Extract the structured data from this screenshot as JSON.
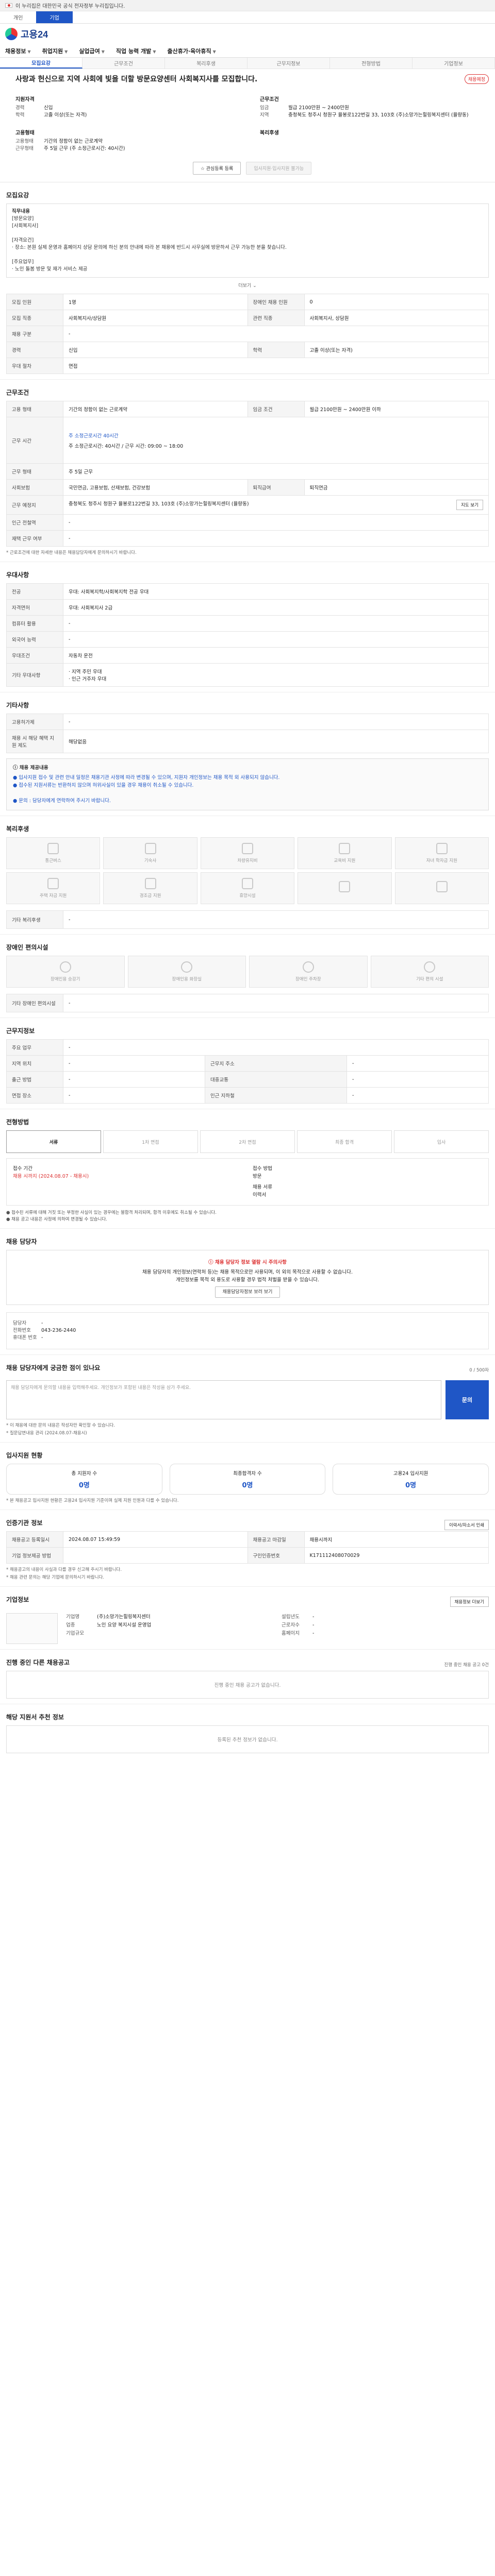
{
  "gov_banner": "이 누리집은 대한민국 공식 전자정부 누리집입니다.",
  "topbar": {
    "tabs": [
      "개인",
      "기업"
    ]
  },
  "logo_text": "고용24",
  "gnb": [
    "채용정보",
    "취업지원",
    "실업급여",
    "직업 능력 개발",
    "출산휴가·육아휴직"
  ],
  "subtabs": [
    "모집요강",
    "근무조건",
    "복리후생",
    "근무지정보",
    "전형방법",
    "기업정보"
  ],
  "header": {
    "company": "",
    "title": "사랑과 헌신으로 지역 사회에 빛을 더할 방문요양센터 사회복지사를 모집합니다.",
    "badge": "채용예정",
    "qual_title": "지원자격",
    "qual": [
      {
        "k": "경력",
        "v": "신입"
      },
      {
        "k": "학력",
        "v": "고졸 이상(또는 자격)"
      }
    ],
    "cond_title": "근무조건",
    "cond": [
      {
        "k": "임금",
        "v": "월급 2100만원 ~ 2400만원"
      },
      {
        "k": "지역",
        "v": "충청북도 청주시 청원구 율봉로122번길 33, 103호 (주)소망가는힐링복지센터 (율량동)"
      }
    ],
    "emp_title": "고용형태",
    "emp": [
      {
        "k": "고용형태",
        "v": "기간의 정함이 없는 근로계약"
      },
      {
        "k": "근무형태",
        "v": "주 5일 근무 (주 소정근로시간: 40시간)"
      }
    ],
    "welfare_title": "복리후생",
    "btn_apply": "관심등록 등록",
    "btn_scrap": "입사지원·입사지원 불가능"
  },
  "recruit": {
    "title": "모집요강",
    "desc_label": "직무내용",
    "desc_lines": [
      "[방문요양]",
      "[사회복지사]",
      "",
      "[자격요건]",
      "· 장소: 본원 실제 운영과 홈페이지 상담 문의에 하신 분의 안내에 따라 본 채용에 반드시 사무실에 방문하셔 근무 가능한 분을 찾습니다.",
      "",
      "[주요업무]",
      "· 노인 돌봄 방문 및 재가 서비스 제공"
    ],
    "more": "더보기",
    "rows": [
      [
        "모집 인원",
        "1명",
        "장애인 채용 인원",
        "0"
      ],
      [
        "모집 직종",
        "사회복지사/상담원",
        "관련 직종",
        "사회복지사, 상담원"
      ],
      [
        "채용 구분",
        "-",
        "",
        ""
      ],
      [
        "경력",
        "신입",
        "학력",
        "고졸 이상(또는 자격)"
      ],
      [
        "우대 절차",
        "면접",
        "",
        ""
      ]
    ]
  },
  "workcond": {
    "title": "근무조건",
    "rows": [
      [
        "고용 형태",
        "기간의 정함이 없는 근로계약",
        "임금 조건",
        "월급 2100만원 ~ 2400만원 이하"
      ],
      [
        "근무 시간",
        "주 소정근로시간: 40시간 / 근무 시간: 09:00 ~ 18:00",
        "",
        ""
      ],
      [
        "근무 형태",
        "주 5일 근무",
        "",
        ""
      ],
      [
        "사회보험",
        "국민연금, 고용보험, 산재보험, 건강보험",
        "퇴직급여",
        "퇴직연금"
      ],
      [
        "근무 예정지",
        "충청북도 청주시 청원구 율봉로122번길 33, 103호 (주)소망가는힐링복지센터 (율량동)",
        "",
        ""
      ],
      [
        "인근 전철역",
        "-",
        "",
        ""
      ],
      [
        "재택 근무 여부",
        "-",
        "",
        ""
      ]
    ],
    "time_detail_label": "주 소정근로시간 40시간",
    "note": "* 근로조건에 대한 자세한 내용은 채용담당자에게 문의하시기 바랍니다.",
    "map_btn": "지도 보기"
  },
  "pref": {
    "title": "우대사항",
    "rows": [
      [
        "전공",
        "우대: 사회복지학/사회복지학 전공 우대"
      ],
      [
        "자격면허",
        "우대: 사회복지사 2급"
      ],
      [
        "컴퓨터 활용",
        "-"
      ],
      [
        "외국어 능력",
        "-"
      ],
      [
        "우대조건",
        "자동차 운전"
      ],
      [
        "기타 우대사항",
        "· 지역 주민 우대\n· 인근 거주자 우대"
      ]
    ]
  },
  "other": {
    "title": "기타사항",
    "rows": [
      [
        "고용허가제",
        "-"
      ],
      [
        "채용 시 해당 혜택 지원 제도",
        "해당없음"
      ]
    ],
    "info_head": "ⓘ 채용 제공내용",
    "info_lines": [
      "● 입사지원 접수 및 관련 안내 일정은 채용기관 사정에 따라 변경될 수 있으며, 지원자 개인정보는 채용 목적 외 사용되지 않습니다.",
      "● 접수된 지원서류는 반환하지 않으며 허위사실이 있을 경우 채용이 취소될 수 있습니다.",
      "",
      "● 문의 : 담당자에게 연락하여 주시기 바랍니다."
    ]
  },
  "welfare": {
    "title": "복리후생",
    "items": [
      "통근버스",
      "기숙사",
      "차량유지비",
      "교육비 지원",
      "자녀 학자금 지원",
      "주택 자금 지원",
      "경조금 지원",
      "휴양시설",
      "",
      ""
    ],
    "etc_label": "기타 복리후생",
    "etc_value": "-"
  },
  "disability": {
    "title": "장애인 편의시설",
    "items": [
      "장애인용 승강기",
      "장애인용 화장실",
      "장애인 주차장",
      "기타 편의 시설"
    ],
    "etc_label": "기타 장애인 편의시설",
    "etc_value": "-"
  },
  "location": {
    "title": "근무지정보",
    "rows": [
      [
        "주요 업무",
        "-",
        "",
        ""
      ],
      [
        "지역 위치",
        "-",
        "근무지 주소",
        "-"
      ],
      [
        "출근 방법",
        "-",
        "대중교통",
        "-"
      ],
      [
        "면접 장소",
        "-",
        "인근 지하철",
        "-"
      ]
    ]
  },
  "process": {
    "title": "전형방법",
    "tabs": [
      "서류",
      "1차 면접",
      "2차 면접",
      "최종 합격",
      "입사"
    ],
    "left_label": "접수 기간",
    "left_value": "채용 시까지 (2024.08.07 - 채용시)",
    "right_label": "접수 방법",
    "right_values": [
      "방문",
      "채용 서류",
      "이력서"
    ],
    "bullets": [
      "● 접수된 서류에 대해 거짓 또는 부정한 사실이 있는 경우에는 불합격 처리되며, 합격 이후에도 취소될 수 있습니다.",
      "● 채용 공고 내용은 사정에 의하여 변경될 수 있습니다."
    ]
  },
  "contact": {
    "title": "채용 담당자",
    "alert_head": "ⓘ 채용 담당자 정보 열람 시 주의사항",
    "alert_lines": [
      "채용 담당자의 개인정보(연락처 등)는 채용 목적으로만 사용되며, 이 외의 목적으로 사용할 수 없습니다.",
      "개인정보를 목적 외 용도로 사용할 경우 법적 처벌을 받을 수 있습니다."
    ],
    "alert_btn": "채용담당자정보 보러 보기",
    "rows": [
      {
        "k": "담당자",
        "v": "-"
      },
      {
        "k": "전화번호",
        "v": "043-236-2440"
      },
      {
        "k": "휴대폰 번호",
        "v": "-"
      }
    ]
  },
  "qna": {
    "title": "채용 담당자에게 궁금한 점이 있나요",
    "counter": "0 / 500자",
    "placeholder": "채용 담당자에게 문의할 내용을 입력해주세요. 개인정보가 포함된 내용은 작성을 삼가 주세요.",
    "button": "문의",
    "notes": [
      "* 이 채용에 대한 문의 내용은 작성자만 확인할 수 있습니다.",
      "* 질문답변내용 관리 (2024.08.07-채용시)"
    ]
  },
  "apply_status": {
    "title": "입사지원 현황",
    "stats": [
      {
        "label": "총 지원자 수",
        "value": "0명"
      },
      {
        "label": "최종합격자 수",
        "value": "0명"
      },
      {
        "label": "고용24 입사지원",
        "value": "0명"
      }
    ],
    "note": "* 본 채용공고 입사지원 현황은 고용24 입사지원 기준이며 실제 지원 인원과 다를 수 있습니다."
  },
  "meta": {
    "title": "인증기관 정보",
    "btn": "이력서/자소서 인쇄",
    "rows": [
      [
        "채용공고 등록일시",
        "2024.08.07 15:49:59",
        "채용공고 마감일",
        "채용시까지"
      ],
      [
        "기업 정보제공 방법",
        "",
        "구인인증번호",
        "K171112408070029"
      ]
    ],
    "notes": [
      "* 채용공고의 내용이 사실과 다를 경우 신고해 주시기 바랍니다.",
      "* 채용 관련 문의는 해당 기업에 문의하시기 바랍니다."
    ]
  },
  "company": {
    "title": "기업정보",
    "btn": "채용정보 더보기",
    "left": [
      {
        "k": "기업명",
        "v": "(주)소망가는힐링복지센터"
      },
      {
        "k": "업종",
        "v": "노인 요양 복지시설 운영업"
      },
      {
        "k": "기업규모",
        "v": ""
      }
    ],
    "right": [
      {
        "k": "설립년도",
        "v": "-"
      },
      {
        "k": "근로자수",
        "v": "-"
      },
      {
        "k": "홈페이지",
        "v": "-"
      }
    ]
  },
  "other_jobs": {
    "title": "진행 중인 다른 채용공고",
    "count": "진행 중인 채용 공고 0건",
    "empty": "진행 중인 채용 공고가 없습니다."
  },
  "recommend": {
    "title": "해당 지원서 추천 정보",
    "empty": "등록된 추천 정보가 없습니다."
  }
}
